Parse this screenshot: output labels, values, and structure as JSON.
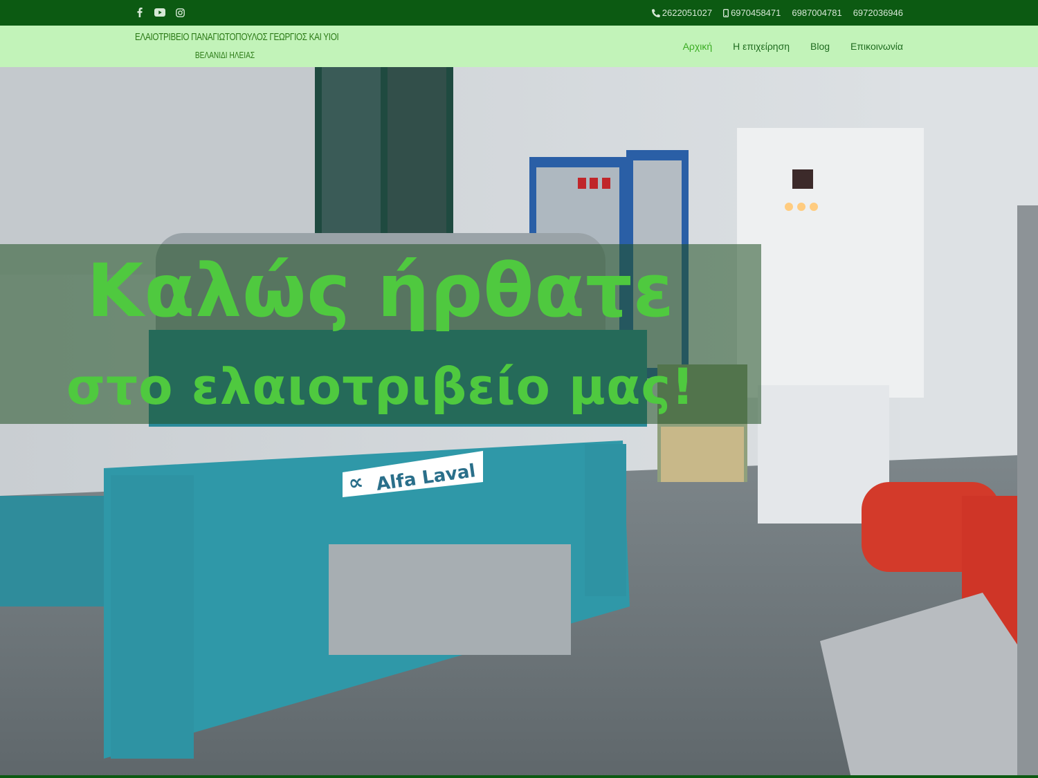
{
  "topbar": {
    "social": [
      {
        "icon": "facebook-icon",
        "glyph": "f"
      },
      {
        "icon": "youtube-icon",
        "glyph": "▶"
      },
      {
        "icon": "instagram-icon",
        "glyph": "◎"
      }
    ],
    "phone_landline": "2622051027",
    "phone_mobiles": [
      "6970458471",
      "6987004781",
      "6972036946"
    ]
  },
  "header": {
    "logo_line1": "ΕΛΑΙΟΤΡΙΒΕΙΟ ΠΑΝΑΓΙΩΤΟΠΟΥΛΟΣ ΓΕΩΡΓΙΟΣ ΚΑΙ ΥΙΟΙ",
    "logo_line2": "ΒΕΛΑΝΙΔΙ ΗΛΕΙΑΣ",
    "nav": [
      {
        "label": "Αρχική",
        "active": true
      },
      {
        "label": "Η επιχείρηση",
        "active": false
      },
      {
        "label": "Blog",
        "active": false
      },
      {
        "label": "Επικοινωνία",
        "active": false
      }
    ]
  },
  "hero": {
    "headline_1": "Καλώς ήρθατε",
    "headline_2": "στο ελαιοτριβείο μας!",
    "machine_brand": "Alfa Laval",
    "colors": {
      "topbar": "#0c5a12",
      "nav_bg": "#c2f3b9",
      "headline": "#4fc93f"
    }
  }
}
